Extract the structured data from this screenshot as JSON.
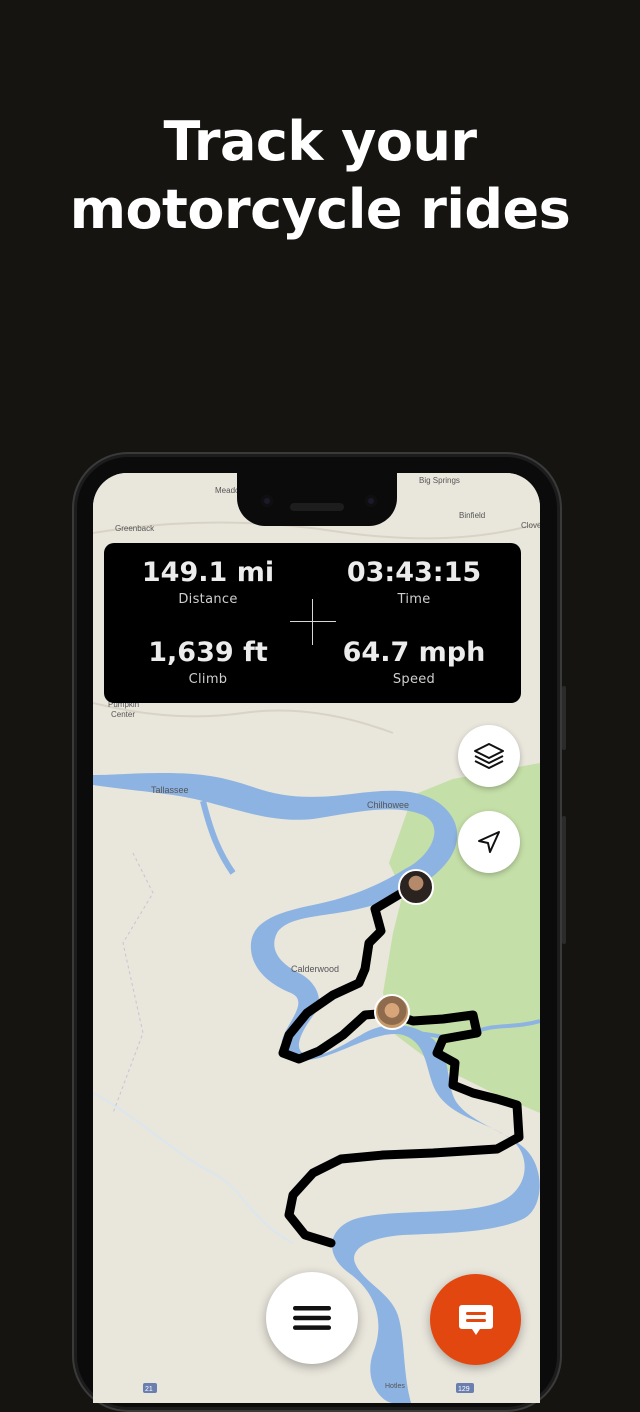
{
  "headline": {
    "line1": "Track your",
    "line2": "motorcycle rides"
  },
  "stats": {
    "distance": {
      "value": "149.1 mi",
      "label": "Distance"
    },
    "time": {
      "value": "03:43:15",
      "label": "Time"
    },
    "climb": {
      "value": "1,639 ft",
      "label": "Climb"
    },
    "speed": {
      "value": "64.7 mph",
      "label": "Speed"
    }
  },
  "map": {
    "labels": {
      "meadow": "Meado",
      "big_springs": "Big Springs",
      "binfield": "Binfield",
      "greenback": "Greenback",
      "clove": "Clove",
      "pumpkin": "Pumpkin",
      "center": "Center",
      "tallassee": "Tallassee",
      "chilhowee": "Chilhowee",
      "calderwood": "Calderwood",
      "hotles": "Hotles"
    },
    "route_sign_left": "21",
    "route_sign_right": "129"
  },
  "controls": {
    "layers_icon": "layers-icon",
    "locate_icon": "navigation-arrow-icon",
    "menu_icon": "hamburger-menu-icon",
    "chat_icon": "chat-bubble-icon"
  },
  "colors": {
    "background": "#161411",
    "accent": "#e2470f",
    "map_land": "#e9e6dc",
    "map_water": "#8db3e2",
    "map_park": "#c5dfa8",
    "route": "#000000"
  }
}
